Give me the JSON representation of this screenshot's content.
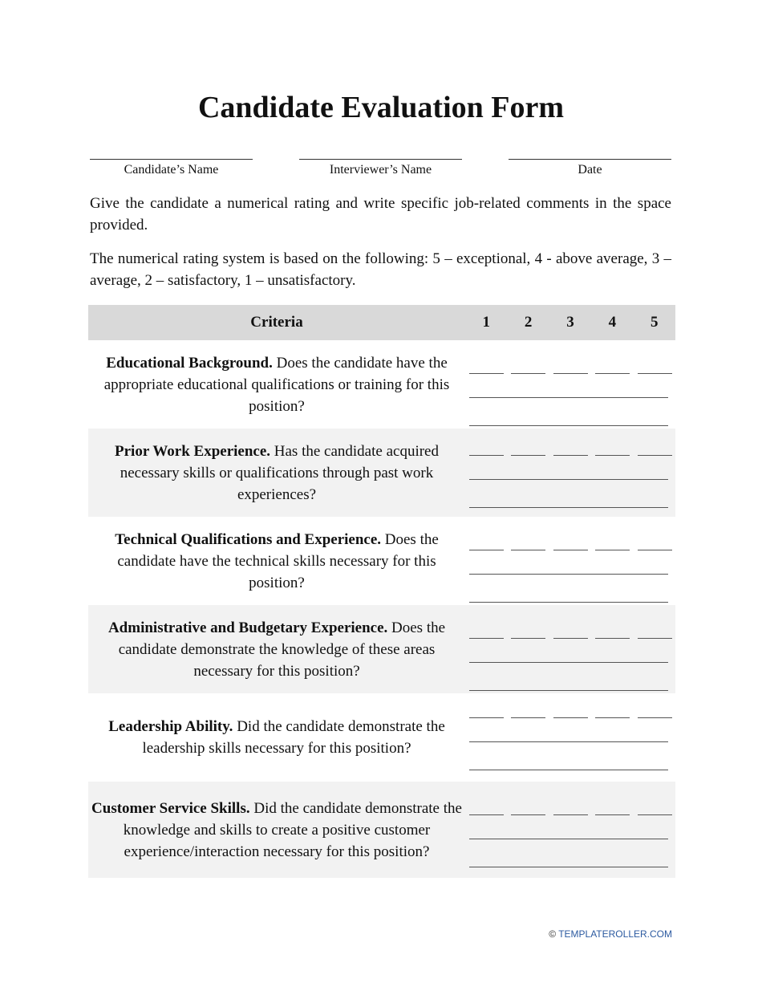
{
  "title": "Candidate Evaluation Form",
  "signatures": [
    "Candidate’s Name",
    "Interviewer’s Name",
    "Date"
  ],
  "instructions": [
    "Give the candidate a numerical rating and write specific job-related comments in the space provided.",
    "The numerical rating system is based on the following: 5 – exceptional, 4 - above average, 3 – average, 2 – satisfactory, 1 – unsatisfactory."
  ],
  "table": {
    "header": {
      "criteria": "Criteria",
      "ratings": [
        "1",
        "2",
        "3",
        "4",
        "5"
      ]
    },
    "rows": [
      {
        "bold": "Educational Background.",
        "text": " Does the candidate have the appropriate educational qualifications or training for this position?"
      },
      {
        "bold": "Prior Work Experience.",
        "text": " Has the candidate acquired necessary skills or qualifications through past work experiences?"
      },
      {
        "bold": "Technical Qualifications and Experience.",
        "text": " Does the candidate have the technical skills necessary for this position?"
      },
      {
        "bold": "Administrative and Budgetary Experience.",
        "text": " Does the candidate demonstrate the knowledge of these areas necessary for this position?"
      },
      {
        "bold": "Leadership Ability.",
        "text": " Did the candidate demonstrate the leadership skills necessary for this position?"
      },
      {
        "bold": "Customer Service Skills.",
        "text": " Did the candidate demonstrate the knowledge and skills to create a positive customer experience/interaction necessary for this position?"
      }
    ]
  },
  "footer": {
    "copyright": "©",
    "link": "TEMPLATEROLLER.COM"
  }
}
